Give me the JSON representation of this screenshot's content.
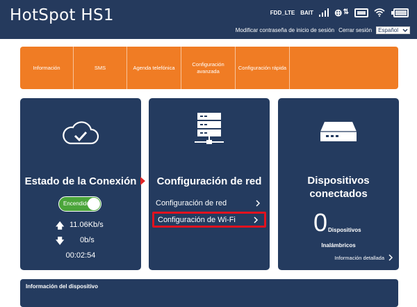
{
  "header": {
    "brand": "HotSpot HS1",
    "network_type": "FDD_LTE",
    "carrier": "BAIT",
    "change_password_link": "Modificar contraseña de inicio de sesión",
    "logout_link": "Cerrar sesión",
    "language": "Español",
    "icons": [
      "signal-icon",
      "globe-icon",
      "data-transfer-icon",
      "sms-icon",
      "wifi-icon",
      "battery-icon"
    ]
  },
  "nav": {
    "items": [
      {
        "label": "Información"
      },
      {
        "label": "SMS"
      },
      {
        "label": "Agenda telefónica"
      },
      {
        "label": "Configuración avanzada"
      },
      {
        "label": "Configuración rápida"
      }
    ],
    "color": "#f07c24"
  },
  "connection": {
    "title": "Estado de la Conexión",
    "toggle_label": "Encendido",
    "upload_rate": "11.06Kb/s",
    "download_rate": "0b/s",
    "uptime": "00:02:54",
    "icons": [
      "cloud-check-icon",
      "arrow-up-icon",
      "arrow-down-icon"
    ]
  },
  "network": {
    "title": "Configuración de red",
    "links": [
      "Configuración de red",
      "Configuración de Wi-Fi"
    ],
    "highlight_color": "#e1121f",
    "icons": [
      "server-icon"
    ]
  },
  "devices": {
    "title": "Dispositivos conectados",
    "count": "0",
    "unit": "Dispositivos",
    "wireless": "Inalámbricos",
    "detail_link": "Información detallada",
    "icons": [
      "router-icon"
    ]
  },
  "device_info": {
    "title": "Información del dispositivo"
  },
  "colors": {
    "header_bg": "#253a5d",
    "card_bg": "#243b5f",
    "toggle_on": "#4ba53a",
    "accent": "#f07c24"
  }
}
